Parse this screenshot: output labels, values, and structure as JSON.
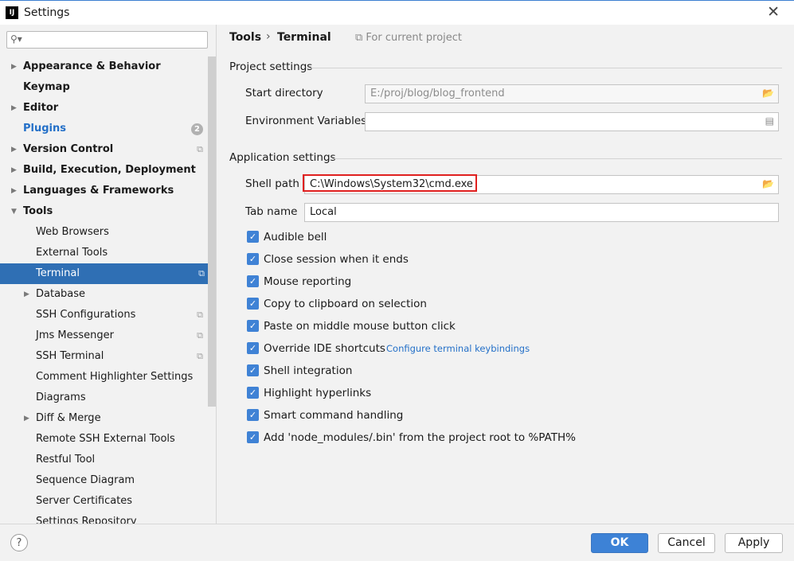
{
  "window": {
    "app_icon": "IJ",
    "title": "Settings",
    "close_glyph": "✕"
  },
  "sidebar": {
    "search_value": "",
    "items": [
      {
        "label": "Appearance & Behavior",
        "arrow": "▶"
      },
      {
        "label": "Keymap",
        "arrow": ""
      },
      {
        "label": "Editor",
        "arrow": "▶"
      },
      {
        "label": "Plugins",
        "arrow": "",
        "badge": "2"
      },
      {
        "label": "Version Control",
        "arrow": "▶"
      },
      {
        "label": "Build, Execution, Deployment",
        "arrow": "▶"
      },
      {
        "label": "Languages & Frameworks",
        "arrow": "▶"
      },
      {
        "label": "Tools",
        "arrow": "▼"
      },
      {
        "label": "Web Browsers",
        "arrow": ""
      },
      {
        "label": "External Tools",
        "arrow": ""
      },
      {
        "label": "Terminal",
        "arrow": ""
      },
      {
        "label": "Database",
        "arrow": "▶"
      },
      {
        "label": "SSH Configurations",
        "arrow": ""
      },
      {
        "label": "Jms Messenger",
        "arrow": ""
      },
      {
        "label": "SSH Terminal",
        "arrow": ""
      },
      {
        "label": "Comment Highlighter Settings",
        "arrow": ""
      },
      {
        "label": "Diagrams",
        "arrow": ""
      },
      {
        "label": "Diff & Merge",
        "arrow": "▶"
      },
      {
        "label": "Remote SSH External Tools",
        "arrow": ""
      },
      {
        "label": "Restful Tool",
        "arrow": ""
      },
      {
        "label": "Sequence Diagram",
        "arrow": ""
      },
      {
        "label": "Server Certificates",
        "arrow": ""
      },
      {
        "label": "Settings Repository",
        "arrow": ""
      }
    ]
  },
  "header": {
    "crumb_parent": "Tools",
    "crumb_sep": "›",
    "crumb_current": "Terminal",
    "scope_label": "For current project"
  },
  "project_settings": {
    "title": "Project settings",
    "start_dir_label": "Start directory",
    "start_dir_value": "E:/proj/blog/blog_frontend",
    "env_label": "Environment Variables",
    "env_value": ""
  },
  "app_settings": {
    "title": "Application settings",
    "shell_label": "Shell path",
    "shell_value": "C:\\Windows\\System32\\cmd.exe",
    "tab_label": "Tab name",
    "tab_value": "Local",
    "checkboxes": [
      {
        "label": "Audible bell",
        "checked": true
      },
      {
        "label": "Close session when it ends",
        "checked": true
      },
      {
        "label": "Mouse reporting",
        "checked": true
      },
      {
        "label": "Copy to clipboard on selection",
        "checked": true
      },
      {
        "label": "Paste on middle mouse button click",
        "checked": true
      },
      {
        "label": "Override IDE shortcuts",
        "checked": true
      },
      {
        "label": "Shell integration",
        "checked": true
      },
      {
        "label": "Highlight hyperlinks",
        "checked": true
      },
      {
        "label": "Smart command handling",
        "checked": true
      },
      {
        "label": "Add 'node_modules/.bin' from the project root to %PATH%",
        "checked": true
      }
    ],
    "keybindings_link": "Configure terminal keybindings"
  },
  "footer": {
    "help": "?",
    "ok": "OK",
    "cancel": "Cancel",
    "apply": "Apply"
  },
  "colors": {
    "accent": "#3d82d6",
    "selection": "#2f6fb4",
    "link": "#2470c8",
    "highlight_box": "#e0201f"
  }
}
